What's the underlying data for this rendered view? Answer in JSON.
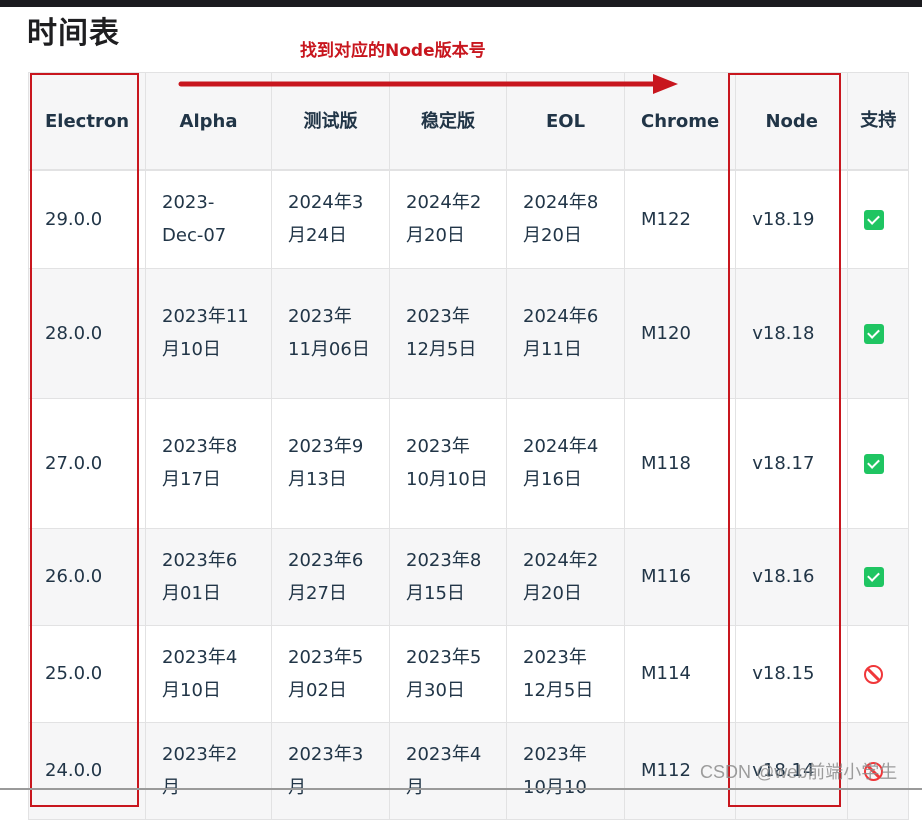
{
  "page": {
    "title": "时间表",
    "annotation": "找到对应的Node版本号",
    "watermark": "CSDN @web前端小学生"
  },
  "colors": {
    "annotation_red": "#c8161e",
    "supported_green": "#1fc562",
    "unsupported_red": "#f0373a"
  },
  "table": {
    "headers": {
      "electron": "Electron",
      "alpha": "Alpha",
      "beta": "测试版",
      "stable": "稳定版",
      "eol": "EOL",
      "chrome": "Chrome",
      "node": "Node",
      "support": "支持"
    },
    "rows": [
      {
        "electron": "29.0.0",
        "alpha": "2023-Dec-07",
        "beta": "2024年3月24日",
        "stable": "2024年2月20日",
        "eol": "2024年8月20日",
        "chrome": "M122",
        "node": "v18.19",
        "support": "supported-check-icon"
      },
      {
        "electron": "28.0.0",
        "alpha": "2023年11月10日",
        "beta": "2023年11月06日",
        "stable": "2023年12月5日",
        "eol": "2024年6月11日",
        "chrome": "M120",
        "node": "v18.18",
        "support": "supported-check-icon"
      },
      {
        "electron": "27.0.0",
        "alpha": "2023年8月17日",
        "beta": "2023年9月13日",
        "stable": "2023年10月10日",
        "eol": "2024年4月16日",
        "chrome": "M118",
        "node": "v18.17",
        "support": "supported-check-icon"
      },
      {
        "electron": "26.0.0",
        "alpha": "2023年6月01日",
        "beta": "2023年6月27日",
        "stable": "2023年8月15日",
        "eol": "2024年2月20日",
        "chrome": "M116",
        "node": "v18.16",
        "support": "supported-check-icon"
      },
      {
        "electron": "25.0.0",
        "alpha": "2023年4月10日",
        "beta": "2023年5月02日",
        "stable": "2023年5月30日",
        "eol": "2023年12月5日",
        "chrome": "M114",
        "node": "v18.15",
        "support": "unsupported-forbid-icon"
      },
      {
        "electron": "24.0.0",
        "alpha": "2023年2月",
        "beta": "2023年3月",
        "stable": "2023年4月",
        "eol": "2023年10月10",
        "chrome": "M112",
        "node": "v18.14",
        "support": "unsupported-forbid-icon"
      }
    ]
  }
}
